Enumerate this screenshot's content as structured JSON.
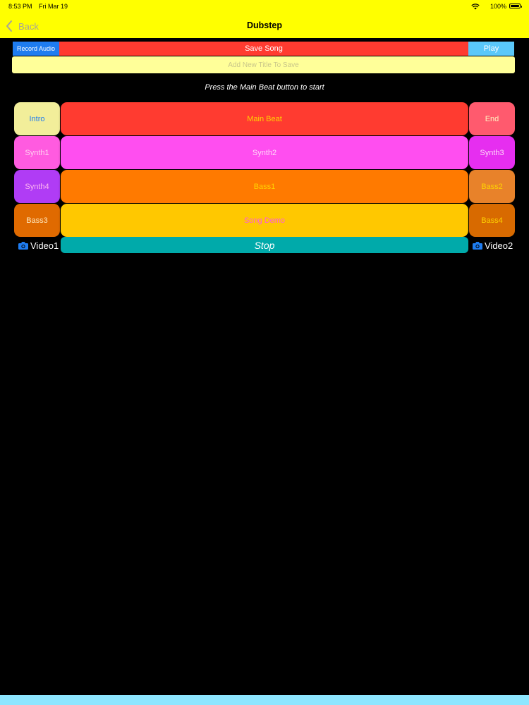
{
  "status_bar": {
    "time": "8:53 PM",
    "date": "Fri Mar 19",
    "battery": "100%"
  },
  "nav": {
    "back_label": "Back",
    "title": "Dubstep"
  },
  "toolbar": {
    "record_audio_label": "Record Audio",
    "save_song_label": "Save Song",
    "play_label": "Play"
  },
  "title_input": {
    "placeholder": "Add New Title To Save",
    "value": ""
  },
  "instruction": "Press the Main Beat button to start",
  "pads": {
    "intro": "Intro",
    "main_beat": "Main Beat",
    "end": "End",
    "synth1": "Synth1",
    "synth2": "Synth2",
    "synth3": "Synth3",
    "synth4": "Synth4",
    "bass1": "Bass1",
    "bass2": "Bass2",
    "bass3": "Bass3",
    "song_demo": "Song Demo",
    "bass4": "Bass4"
  },
  "controls": {
    "video1_label": "Video1",
    "stop_label": "Stop",
    "video2_label": "Video2"
  },
  "colors": {
    "nav_background": "#ffff00",
    "record_audio": "#1e7cf0",
    "save_song": "#ff3b30",
    "play": "#5ac8fa",
    "title_field": "#ffff99",
    "intro": "#f2ee9a",
    "main_beat": "#ff3b30",
    "end": "#ff5a6e",
    "synth1": "#ff5be0",
    "synth2": "#ff4ef0",
    "synth3": "#e62ef0",
    "synth4": "#b03cf5",
    "bass1": "#ff7a00",
    "bass2": "#e8822a",
    "bass3": "#e06a00",
    "song_demo": "#ffc800",
    "bass4": "#d86a00",
    "stop": "#00aaaa",
    "bottom_bar": "#8ee6ff"
  },
  "icons": [
    "chevron-left-icon",
    "wifi-icon",
    "battery-icon",
    "camera-icon"
  ]
}
